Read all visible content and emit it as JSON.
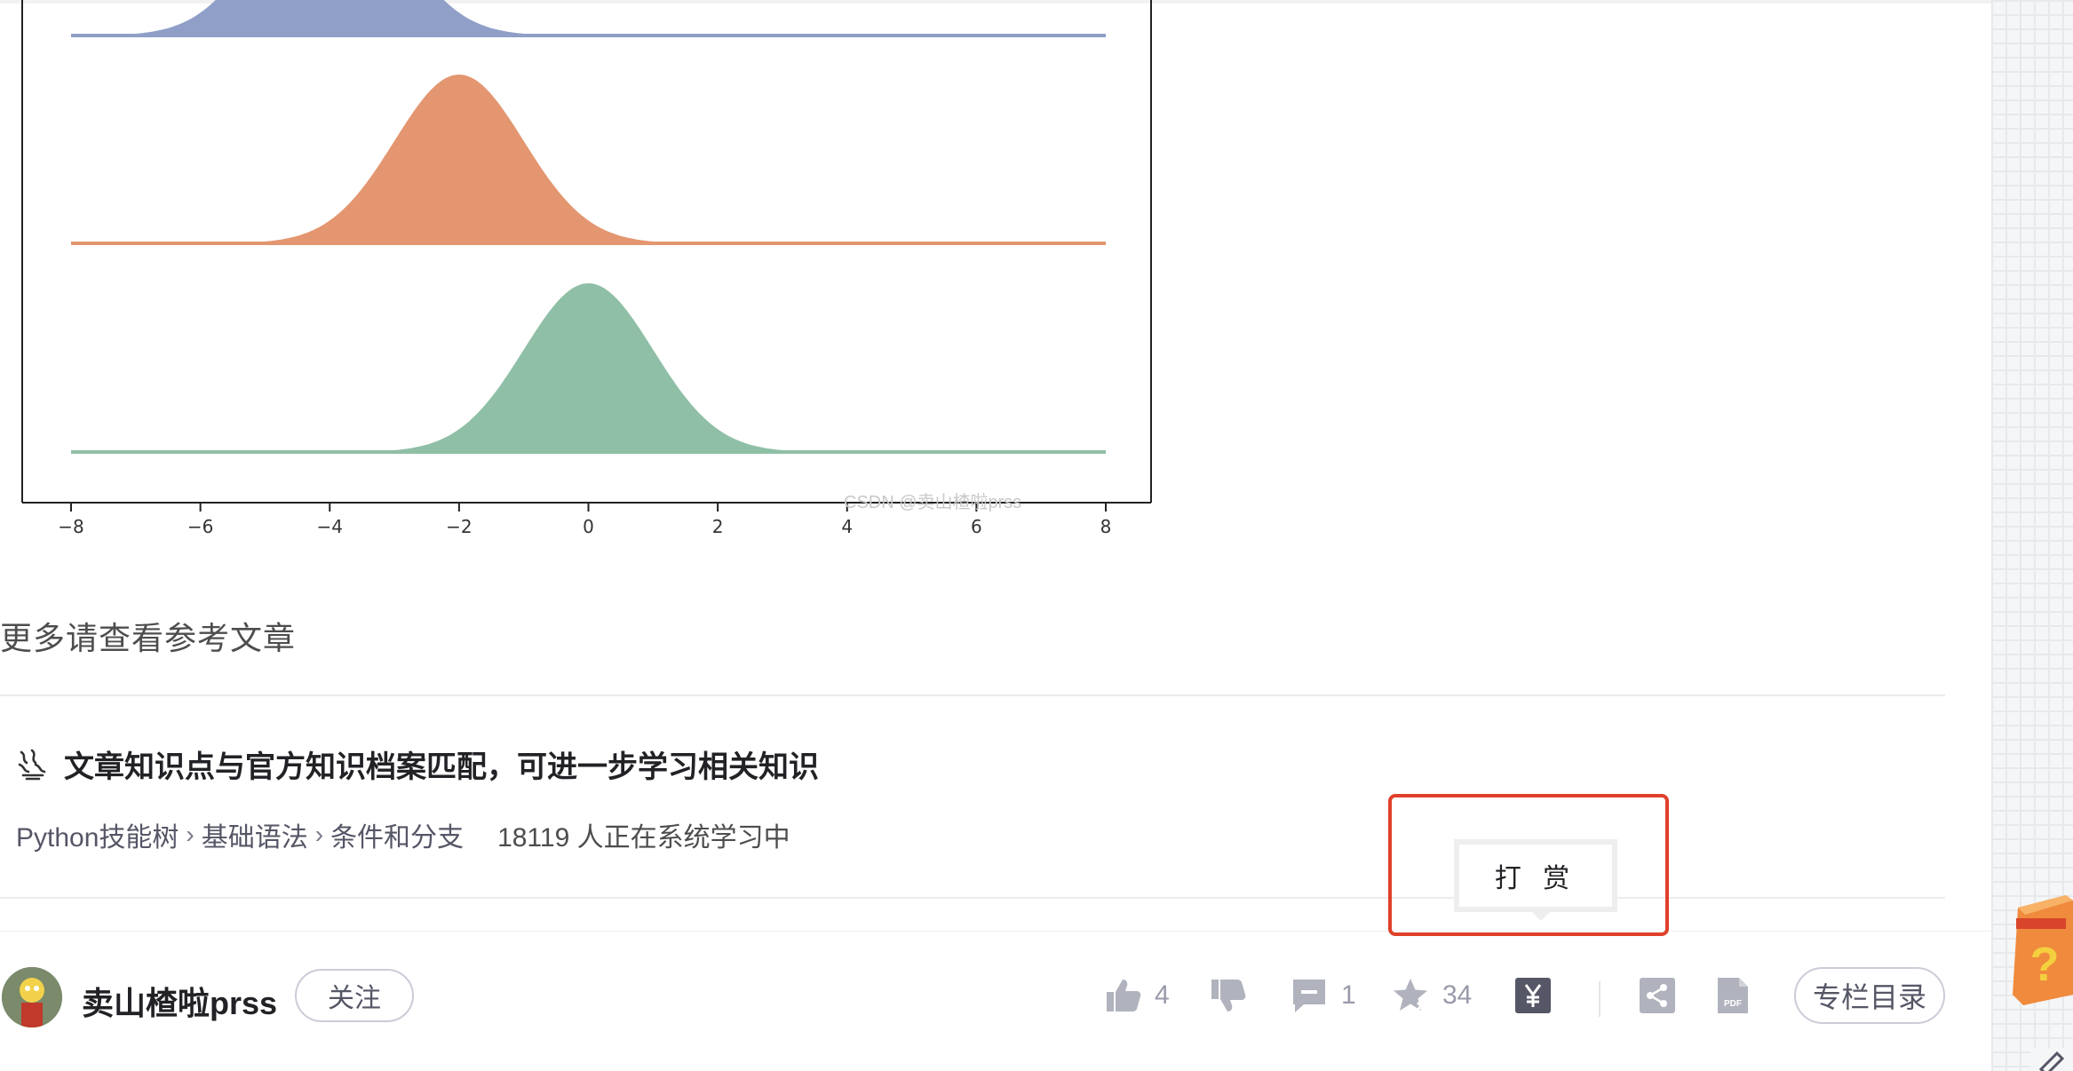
{
  "chart_data": {
    "type": "area",
    "x_ticks": [
      "−8",
      "−6",
      "−4",
      "−2",
      "0",
      "2",
      "4",
      "6",
      "8"
    ],
    "xlim": [
      -8,
      8
    ],
    "series": [
      {
        "mean": -4,
        "std": 1,
        "color": "#8f9fc8"
      },
      {
        "mean": -2,
        "std": 1,
        "color": "#e39670"
      },
      {
        "mean": 0,
        "std": 1,
        "color": "#8fbfa6"
      }
    ],
    "watermark": "CSDN @卖山楂啦prss"
  },
  "article": {
    "more_text": "更多请查看参考文章"
  },
  "knowledge": {
    "title": "文章知识点与官方知识档案匹配，可进一步学习相关知识",
    "path": [
      "Python技能树",
      "基础语法",
      "条件和分支"
    ],
    "separator": "›",
    "learners": "18119 人正在系统学习中"
  },
  "tooltip": {
    "label": "打 赏"
  },
  "toolbar": {
    "username": "卖山楂啦prss",
    "follow_label": "关注",
    "like_count": "4",
    "comment_count": "1",
    "favorite_count": "34",
    "catalog_label": "专栏目录"
  },
  "colors": {
    "accent_red": "#e0402a",
    "icon_gray": "#b0b3bd",
    "reward_icon": "#555666"
  }
}
